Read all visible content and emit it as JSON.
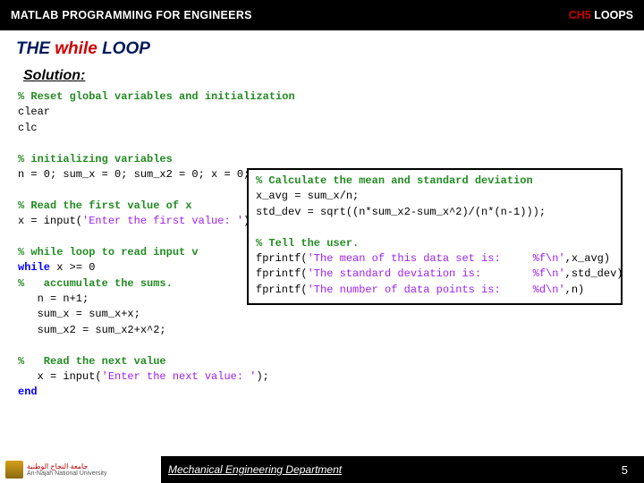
{
  "header": {
    "title": "MATLAB PROGRAMMING FOR ENGINEERS",
    "chapter_prefix": "CH5",
    "chapter_rest": " LOOPS"
  },
  "section": {
    "prefix": "THE ",
    "while_word": "while",
    "suffix": " LOOP"
  },
  "solution_label": "Solution:",
  "code": {
    "c1": "% Reset global variables and initialization",
    "l2": "clear",
    "l3": "clc",
    "c4": "% initializing variables",
    "l5": "n = 0; sum_x = 0; sum_x2 = 0; x = 0;",
    "c6": "% Read the first value of x",
    "l7a": "x = input(",
    "l7s": "'Enter the first value: '",
    "l7b": ");",
    "c8": "% while loop to read input v",
    "l9a": "while",
    "l9b": " x >= 0",
    "c10": "%   accumulate the sums.",
    "l11": "   n = n+1;",
    "l12": "   sum_x = sum_x+x;",
    "l13": "   sum_x2 = sum_x2+x^2;",
    "c14": "%   Read the next value",
    "l15a": "   x = input(",
    "l15s": "'Enter the next value: '",
    "l15b": ");",
    "l16": "end"
  },
  "inset": {
    "c1": "% Calculate the mean and standard deviation",
    "l2": "x_avg = sum_x/n;",
    "l3": "std_dev = sqrt((n*sum_x2-sum_x^2)/(n*(n-1)));",
    "c4": "% Tell the user.",
    "l5a": "fprintf(",
    "l5s": "'The mean of this data set is:     %f\\n'",
    "l5b": ",x_avg)",
    "l6a": "fprintf(",
    "l6s": "'The standard deviation is:        %f\\n'",
    "l6b": ",std_dev)",
    "l7a": "fprintf(",
    "l7s": "'The number of data points is:     %d\\n'",
    "l7b": ",n)"
  },
  "footer": {
    "uni_ar": "جامعة النجاح الوطنية",
    "uni_en": "An-Najah National University",
    "dept": "Mechanical Engineering Department",
    "page": "5"
  }
}
